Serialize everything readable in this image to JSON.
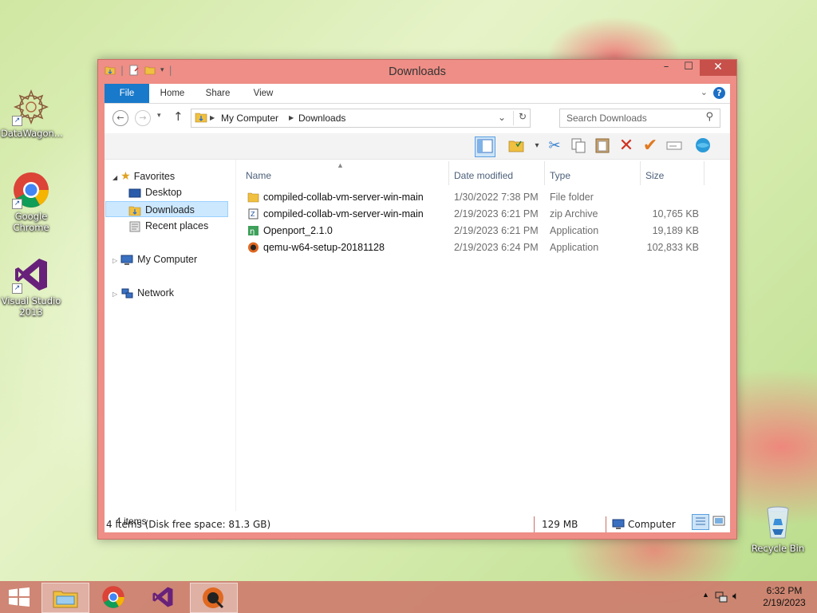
{
  "desktop": {
    "icons": [
      {
        "label": "DataWagon...",
        "icon": "datawagon-icon"
      },
      {
        "label": "Google Chrome",
        "icon": "chrome-icon"
      },
      {
        "label": "Visual Studio 2013",
        "icon": "visual-studio-icon"
      },
      {
        "label": "Recycle Bin",
        "icon": "recycle-bin-icon"
      }
    ]
  },
  "window": {
    "title": "Downloads",
    "controls": {
      "minimize": "–",
      "maximize": "☐",
      "close": "✕"
    },
    "ribbon_tabs": [
      "File",
      "Home",
      "Share",
      "View"
    ],
    "address": {
      "segments": [
        "My Computer",
        "Downloads"
      ]
    },
    "search": {
      "placeholder": "Search Downloads"
    },
    "nav": {
      "favorites": "Favorites",
      "favorites_items": [
        "Desktop",
        "Downloads",
        "Recent places"
      ],
      "my_computer": "My Computer",
      "network": "Network",
      "selected": "Downloads"
    },
    "columns": [
      "Name",
      "Date modified",
      "Type",
      "Size"
    ],
    "files": [
      {
        "name": "compiled-collab-vm-server-win-main",
        "date": "1/30/2022 7:38 PM",
        "type": "File folder",
        "size": "",
        "icon": "folder-icon"
      },
      {
        "name": "compiled-collab-vm-server-win-main",
        "date": "2/19/2023 6:21 PM",
        "type": "zip Archive",
        "size": "10,765 KB",
        "icon": "zip-icon"
      },
      {
        "name": "Openport_2.1.0",
        "date": "2/19/2023 6:21 PM",
        "type": "Application",
        "size": "19,189 KB",
        "icon": "openport-app-icon"
      },
      {
        "name": "qemu-w64-setup-20181128",
        "date": "2/19/2023 6:24 PM",
        "type": "Application",
        "size": "102,833 KB",
        "icon": "qemu-app-icon"
      }
    ],
    "item_count": "4 items",
    "status": {
      "left": "4 items (Disk free space: 81.3 GB)",
      "middle": "129 MB",
      "right": "Computer"
    }
  },
  "taskbar": {
    "items": [
      "file-explorer-icon",
      "chrome-icon",
      "visual-studio-icon",
      "qemu-icon"
    ],
    "time": "6:32 PM",
    "date": "2/19/2023"
  }
}
